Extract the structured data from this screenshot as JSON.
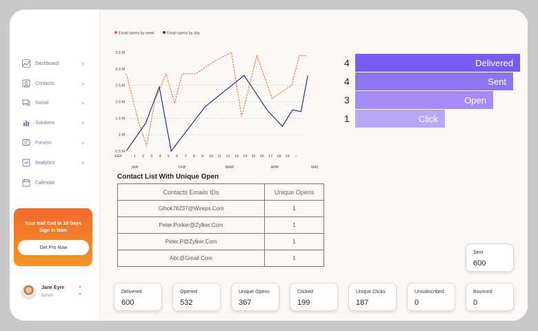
{
  "sidebar": {
    "items": [
      {
        "label": "Dashboard",
        "icon": "chart-line-icon",
        "chevron": "›"
      },
      {
        "label": "Contacts",
        "icon": "contacts-icon",
        "chevron": "›"
      },
      {
        "label": "Social",
        "icon": "chat-icon",
        "chevron": "›"
      },
      {
        "label": "Solutions",
        "icon": "bar-chart-icon",
        "chevron": "›"
      },
      {
        "label": "Forums",
        "icon": "forum-icon",
        "chevron": "›"
      },
      {
        "label": "Analytics",
        "icon": "analytics-icon",
        "chevron": "›"
      },
      {
        "label": "Calendar",
        "icon": "calendar-icon",
        "chevron": ""
      }
    ],
    "promo": {
      "line1": "Your trail End in 10 Days",
      "line2": "Sign In Now",
      "button": "Get Pro Now"
    },
    "user": {
      "name": "Jane Eyre",
      "role": "Admin",
      "toggle_up": "⌃",
      "toggle_down": "⌄"
    }
  },
  "colors": {
    "accent_orange": "#f26a2a",
    "line_week": "#e0623a",
    "line_day": "#1e3a6e",
    "funnel_1": "#7b5cf0",
    "funnel_2": "#8f74f2",
    "funnel_3": "#a48cf4",
    "funnel_4": "#baa7f7"
  },
  "chart_data": {
    "type": "line",
    "legend": [
      "Email opens by week",
      "Email opens by day"
    ],
    "legend_position": "top-left",
    "y_ticks": [
      "0.5 M",
      "1 M",
      "1.5 M",
      "2.0 M",
      "2.5 M",
      "3.0 M",
      "3.5 M"
    ],
    "ylim": [
      0.5,
      3.5
    ],
    "x_ticks": [
      "WEEK",
      "1",
      "2",
      "3",
      "4",
      "5",
      "6",
      "7",
      "8",
      "9",
      "10",
      "11",
      "12",
      "13",
      "14",
      "15",
      "16",
      "17",
      "18",
      "19",
      "›"
    ],
    "month_labels": [
      "JAN",
      "FEB",
      "MAR",
      "APR",
      "MAI"
    ],
    "grid_y": [
      1.0,
      1.5,
      2.0,
      2.5
    ],
    "series": [
      {
        "name": "Email opens by week",
        "style": "dashed",
        "x": [
          0,
          1.5,
          2.4,
          3.4,
          4.7,
          5.7,
          6.6,
          8.2,
          10.5,
          12.4,
          13.6,
          15.4,
          17.2,
          19.5,
          20.4,
          21.2
        ],
        "y": [
          2.85,
          1.35,
          0.65,
          2.05,
          2.85,
          1.95,
          2.85,
          2.85,
          3.25,
          3.5,
          1.55,
          3.4,
          2.1,
          2.5,
          3.4,
          3.4
        ]
      },
      {
        "name": "Email opens by day",
        "style": "solid",
        "x": [
          0,
          2.3,
          3.9,
          5.3,
          9.3,
          13.9,
          16.6,
          18.4,
          19.6,
          20.6,
          21.4
        ],
        "y": [
          0.5,
          1.35,
          2.45,
          0.5,
          1.85,
          2.8,
          1.75,
          1.25,
          1.75,
          1.7,
          2.8
        ]
      }
    ]
  },
  "funnel": [
    {
      "count": "4",
      "label": "Delivered",
      "fraction": 0.92
    },
    {
      "count": "4",
      "label": "Sent",
      "fraction": 0.88
    },
    {
      "count": "3",
      "label": "Open",
      "fraction": 0.77
    },
    {
      "count": "1",
      "label": "Click",
      "fraction": 0.5
    }
  ],
  "contacts_table": {
    "title": "Contact List With Unique Open",
    "headers": [
      "Contacts Emails IDs",
      "Unique Opens"
    ],
    "rows": [
      {
        "email": "Gihok76237@Wireps.Com",
        "opens": "1"
      },
      {
        "email": "Peter.Porker@Zylker.Com",
        "opens": "1"
      },
      {
        "email": "Peter.P@Zylker.Com",
        "opens": "1"
      },
      {
        "email": "Abc@Gmail.Com",
        "opens": "1"
      }
    ]
  },
  "stats": {
    "sent": {
      "label": "Sent",
      "value": "600"
    },
    "cards": [
      {
        "label": "Delivered",
        "value": "600"
      },
      {
        "label": "Opened",
        "value": "532"
      },
      {
        "label": "Unique Opens",
        "value": "367"
      },
      {
        "label": "Clicked",
        "value": "199"
      },
      {
        "label": "Unique Clicks",
        "value": "187"
      },
      {
        "label": "Unsubscribed",
        "value": "0"
      },
      {
        "label": "Bounced",
        "value": "0"
      }
    ]
  }
}
